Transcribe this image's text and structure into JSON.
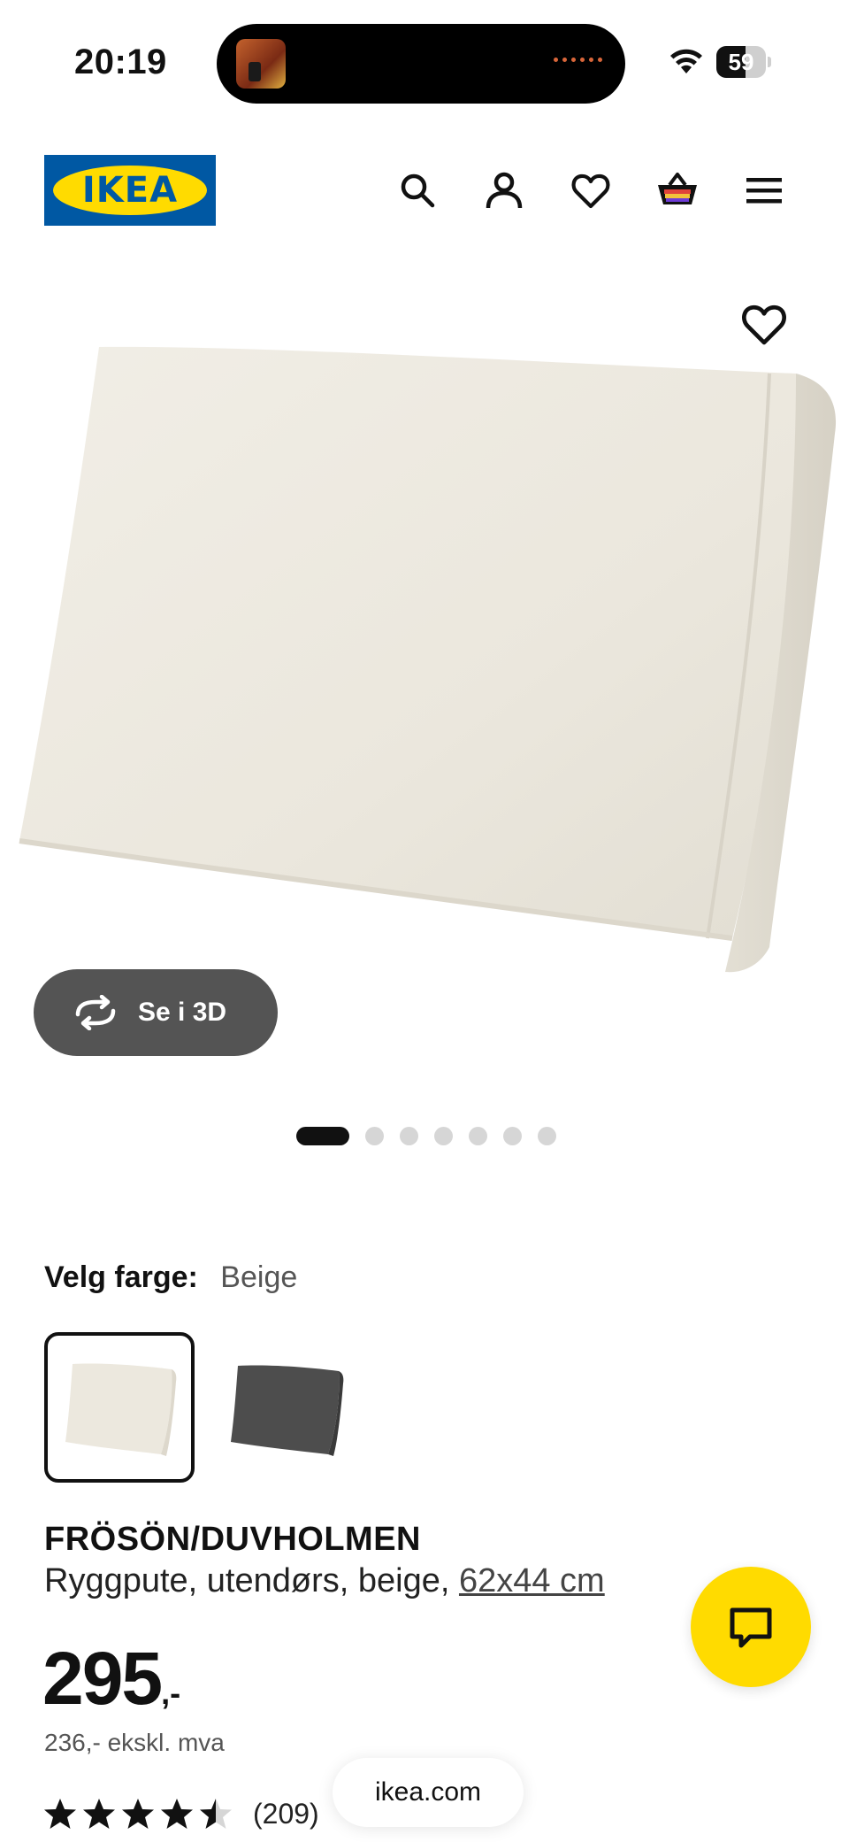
{
  "status_bar": {
    "time": "20:19",
    "battery_level": "59",
    "battery_fraction": 0.59,
    "icons": [
      "wifi-icon",
      "battery-icon"
    ]
  },
  "header": {
    "logo_text": "IKEA",
    "brand_colors": {
      "blue": "#0058a3",
      "yellow": "#ffdb00"
    },
    "icons": [
      "search-icon",
      "account-icon",
      "favorites-heart-icon",
      "cart-icon",
      "menu-icon"
    ]
  },
  "gallery": {
    "see_3d_label": "Se i 3D",
    "dot_count": 7,
    "active_index": 0
  },
  "color_selector": {
    "label": "Velg farge:",
    "selected": "Beige",
    "options": [
      "Beige",
      "Mørk grå"
    ]
  },
  "product": {
    "name": "FRÖSÖN/DUVHOLMEN",
    "description_prefix": "Ryggpute, utendørs, beige,",
    "size_link": "62x44 cm",
    "price_integer": "295",
    "price_suffix": ",-",
    "price_ex_vat": "236,- ekskl. mva",
    "rating_value": 4.5,
    "rating_count": "(209)"
  },
  "browser": {
    "url": "ikea.com"
  },
  "colors": {
    "chat_button": "#ffdb00",
    "see_3d_bg": "#545454",
    "cushion_beige": "#ece8de",
    "cushion_dark": "#4d4d4d"
  }
}
